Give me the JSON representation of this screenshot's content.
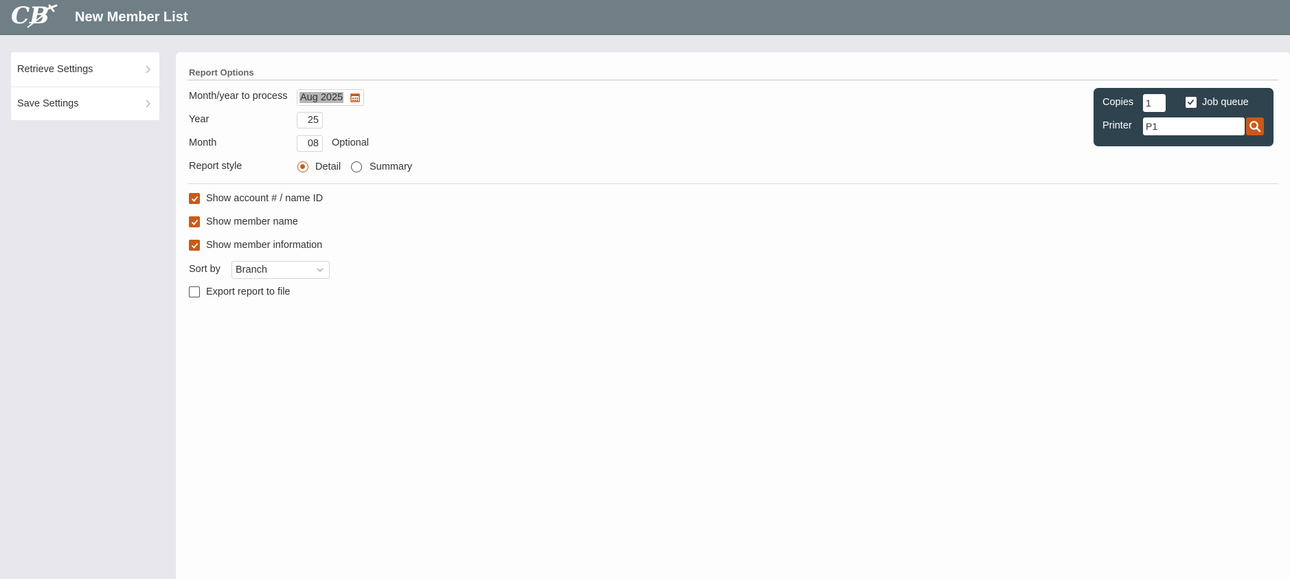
{
  "header": {
    "title": "New Member List",
    "logo_text": "CB"
  },
  "sidebar": {
    "items": [
      {
        "label": "Retrieve Settings"
      },
      {
        "label": "Save Settings"
      }
    ]
  },
  "report_options": {
    "section_title": "Report Options",
    "month_year": {
      "label": "Month/year to process",
      "value": "Aug 2025"
    },
    "year": {
      "label": "Year",
      "value": "25"
    },
    "month": {
      "label": "Month",
      "value": "08",
      "hint": "Optional"
    },
    "report_style": {
      "label": "Report style",
      "options": [
        {
          "label": "Detail",
          "selected": true
        },
        {
          "label": "Summary",
          "selected": false
        }
      ]
    },
    "checkboxes": [
      {
        "label": "Show account # / name ID",
        "checked": true
      },
      {
        "label": "Show member name",
        "checked": true
      },
      {
        "label": "Show member information",
        "checked": true
      }
    ],
    "sort_by": {
      "label": "Sort by",
      "value": "Branch"
    },
    "export": {
      "label": "Export report to file",
      "checked": false
    }
  },
  "print_options": {
    "copies_label": "Copies",
    "copies_value": "1",
    "job_queue_label": "Job queue",
    "job_queue_checked": true,
    "printer_label": "Printer",
    "printer_value": "P1"
  },
  "colors": {
    "header_bg": "#6f7f85",
    "accent": "#c85a1a",
    "print_box_bg": "#2f434e"
  },
  "icons": [
    "logo",
    "chevron-right-icon",
    "calendar-icon",
    "chevron-down-icon",
    "checkmark-icon",
    "search-icon"
  ]
}
